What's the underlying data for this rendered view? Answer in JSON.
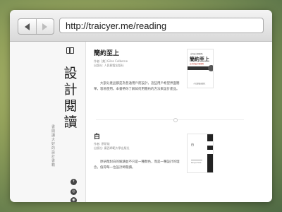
{
  "browser": {
    "url": "http://traicyer.me/reading"
  },
  "sidebar": {
    "logo": "設計閱讀",
    "tagline": "書閱讀大好的設計書籍",
    "social_icons": [
      "twitter-icon",
      "dribbble-icon",
      "rss-icon"
    ]
  },
  "posts": [
    {
      "title": "簡約至上",
      "meta_author": "作者: [美] Giles Colborne",
      "meta_publisher": "出版社: 人民郵電出版社",
      "body": "大部分產品都是為普通用戶而設計，這些用戶希望界面簡單，容易使用。本書帶你了解如何用簡約的方法來設計產品。",
      "cover": {
        "top": "交互设计四策略",
        "title": "簡約至上",
        "subtitle": "交互式设计四策略",
        "publisher": "人民郵電出版社"
      }
    },
    {
      "title": "白",
      "meta_author": "作者: 原研哉",
      "meta_publisher": "出版社: 廣西師範大學出版社",
      "body": "原研哉對白的解讀並不只是一種顏色，而是一種設計的理念，值得每一位設計師閱讀。",
      "cover": {
        "char": "白",
        "english": "Kenya Hara"
      }
    }
  ]
}
